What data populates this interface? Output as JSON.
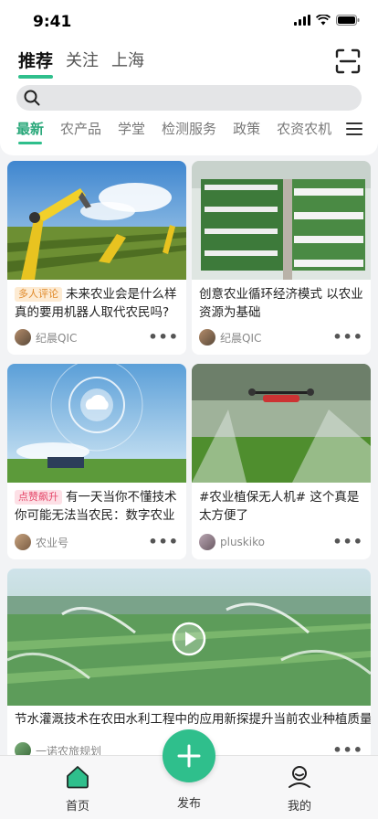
{
  "status_bar": {
    "time": "9:41"
  },
  "top_tabs": [
    {
      "label": "推荐",
      "active": true
    },
    {
      "label": "关注",
      "active": false
    },
    {
      "label": "上海",
      "active": false
    }
  ],
  "search": {
    "placeholder": ""
  },
  "categories": [
    {
      "label": "最新",
      "active": true
    },
    {
      "label": "农产品",
      "active": false
    },
    {
      "label": "学堂",
      "active": false
    },
    {
      "label": "检测服务",
      "active": false
    },
    {
      "label": "政策",
      "active": false
    },
    {
      "label": "农资农机",
      "active": false
    }
  ],
  "cards": [
    {
      "tag": "多人评论",
      "title": "未来农业会是什么样真的要用机器人取代农民吗?",
      "author": "纪晨QIC"
    },
    {
      "tag": "",
      "title": "创意农业循环经济模式 以农业资源为基础",
      "author": "纪晨QIC"
    },
    {
      "tag": "点赞飙升",
      "title": "有一天当你不懂技术你可能无法当农民：数字农业",
      "author": "农业号"
    },
    {
      "tag": "",
      "title": "#农业植保无人机# 这个真是太方便了",
      "author": "pluskiko"
    }
  ],
  "wide_card": {
    "title": "节水灌溉技术在农田水利工程中的应用新探提升当前农业种植质量",
    "author": "一诺农旅规划"
  },
  "tabbar": {
    "home": "首页",
    "publish": "发布",
    "mine": "我的"
  },
  "colors": {
    "accent": "#2fbf8c"
  }
}
